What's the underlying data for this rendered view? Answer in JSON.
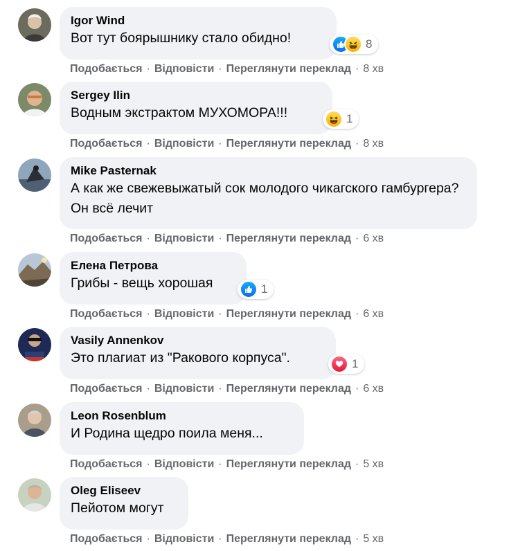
{
  "colors": {
    "bubble": "#f0f2f5",
    "meta": "#65676b",
    "like": "#1877f2",
    "haha": "#f7b928",
    "love": "#f33e58"
  },
  "comments": [
    {
      "author": "Igor Wind",
      "text": "Вот тут боярышнику стало обидно!",
      "reactions": [
        "like",
        "haha"
      ],
      "count": "8",
      "like": "Подобається",
      "reply": "Відповісти",
      "translate": "Переглянути переклад",
      "time": "8 хв"
    },
    {
      "author": "Sergey Ilin",
      "text": "Водным экстрактом МУХОМОРА!!!",
      "reactions": [
        "haha"
      ],
      "count": "1",
      "like": "Подобається",
      "reply": "Відповісти",
      "translate": "Переглянути переклад",
      "time": "8 хв"
    },
    {
      "author": "Mike Pasternak",
      "text": "А как же свежевыжатый сок молодого чикагского гамбургера? Он всё лечит",
      "reactions": [],
      "count": "",
      "like": "Подобається",
      "reply": "Відповісти",
      "translate": "Переглянути переклад",
      "time": "6 хв"
    },
    {
      "author": "Елена Петрова",
      "text": "Грибы - вещь хорошая",
      "reactions": [
        "like"
      ],
      "count": "1",
      "like": "Подобається",
      "reply": "Відповісти",
      "translate": "Переглянути переклад",
      "time": "6 хв"
    },
    {
      "author": "Vasily Annenkov",
      "text": "Это плагиат из \"Ракового корпуса\".",
      "reactions": [
        "love"
      ],
      "count": "1",
      "like": "Подобається",
      "reply": "Відповісти",
      "translate": "Переглянути переклад",
      "time": "6 хв"
    },
    {
      "author": "Leon Rosenblum",
      "text": "И Родина щедро поила меня...",
      "reactions": [],
      "count": "",
      "like": "Подобається",
      "reply": "Відповісти",
      "translate": "Переглянути переклад",
      "time": "5 хв"
    },
    {
      "author": "Oleg Eliseev",
      "text": "Пейотом могут",
      "reactions": [],
      "count": "",
      "like": "Подобається",
      "reply": "Відповісти",
      "translate": "Переглянути переклад",
      "time": "5 хв"
    }
  ]
}
